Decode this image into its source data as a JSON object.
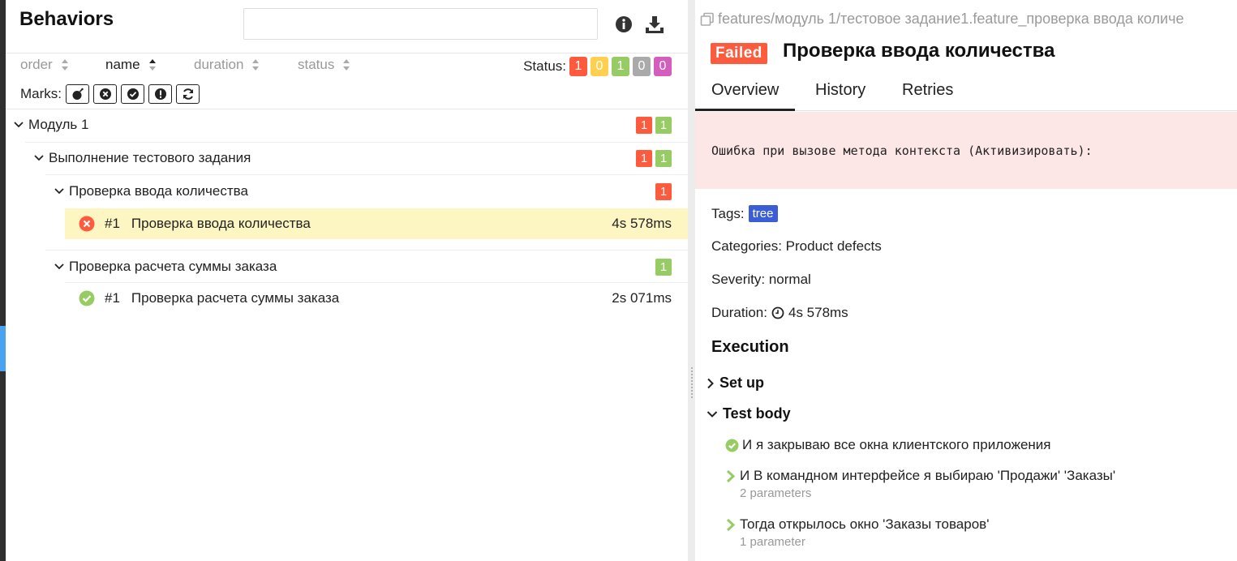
{
  "left": {
    "title": "Behaviors",
    "search": {
      "value": "",
      "placeholder": ""
    },
    "sort": {
      "order": "order",
      "name": "name",
      "duration": "duration",
      "status": "status"
    },
    "status_label": "Status:",
    "status_counts": {
      "failed": "1",
      "broken": "0",
      "passed": "1",
      "skipped": "0",
      "unknown": "0"
    },
    "marks_label": "Marks:",
    "tree": {
      "module": {
        "label": "Модуль 1",
        "failed": "1",
        "passed": "1"
      },
      "feature": {
        "label": "Выполнение тестового задания",
        "failed": "1",
        "passed": "1"
      },
      "story1": {
        "label": "Проверка ввода количества",
        "failed": "1"
      },
      "case1": {
        "num": "#1",
        "label": "Проверка ввода количества",
        "duration": "4s 578ms"
      },
      "story2": {
        "label": "Проверка расчета суммы заказа",
        "passed": "1"
      },
      "case2": {
        "num": "#1",
        "label": "Проверка расчета суммы заказа",
        "duration": "2s 071ms"
      }
    }
  },
  "right": {
    "path": "features/модуль 1/тестовое задание1.feature_проверка ввода количе",
    "status_badge": "Failed",
    "test_name": "Проверка ввода количества",
    "tabs": [
      "Overview",
      "History",
      "Retries"
    ],
    "error_message": "Ошибка при вызове метода контекста (Активизировать):",
    "tags_label": "Tags:",
    "tag": "tree",
    "categories": "Categories: Product defects",
    "severity": "Severity: normal",
    "duration_label": "Duration:",
    "duration": "4s 578ms",
    "execution_title": "Execution",
    "setup_label": "Set up",
    "testbody_label": "Test body",
    "steps": [
      {
        "text": "И я закрываю все окна клиентского приложения",
        "sub": ""
      },
      {
        "text": "И В командном интерфейсе я выбираю 'Продажи' 'Заказы'",
        "sub": "2 parameters"
      },
      {
        "text": "Тогда открылось окно 'Заказы товаров'",
        "sub": "1 parameter"
      }
    ]
  },
  "colors": {
    "failed": "#fd5a3e",
    "passed": "#97cc64",
    "broken": "#ffd050",
    "skipped": "#aaaaaa",
    "unknown": "#d35ebe",
    "tag": "#3b5dd6",
    "error_bg": "#fde6e6",
    "selected_row": "#fdf6c3"
  }
}
